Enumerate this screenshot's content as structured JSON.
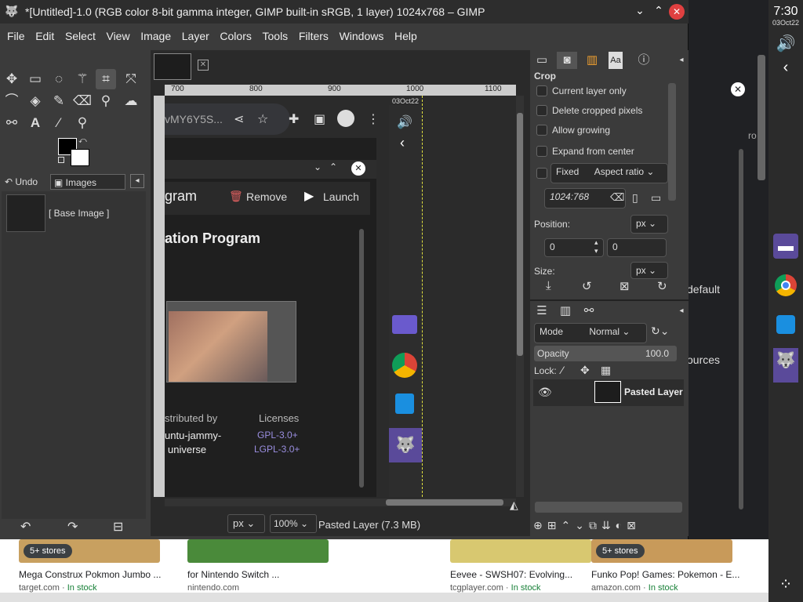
{
  "window": {
    "title": "*[Untitled]-1.0 (RGB color 8-bit gamma integer, GIMP built-in sRGB, 1 layer) 1024x768 – GIMP"
  },
  "system": {
    "time": "7:30",
    "date": "03Oct22"
  },
  "menubar": [
    "File",
    "Edit",
    "Select",
    "View",
    "Image",
    "Layer",
    "Colors",
    "Tools",
    "Filters",
    "Windows",
    "Help"
  ],
  "toolbox_tabs": {
    "undo": "Undo",
    "images": "Images"
  },
  "undo_history": {
    "base_image": "[ Base Image ]"
  },
  "crop": {
    "title": "Crop",
    "current_layer_only": "Current layer only",
    "delete_cropped_pixels": "Delete cropped pixels",
    "allow_growing": "Allow growing",
    "expand_from_center": "Expand from center",
    "fixed": "Fixed",
    "aspect_ratio": "Aspect ratio",
    "ratio_value": "1024:768",
    "position_label": "Position:",
    "unit_px": "px",
    "pos_x": "0",
    "pos_y": "0",
    "size_label": "Size:"
  },
  "layers": {
    "mode_label": "Mode",
    "mode_value": "Normal",
    "opacity_label": "Opacity",
    "opacity_value": "100.0",
    "lock_label": "Lock:",
    "layer_name": "Pasted Layer"
  },
  "statusbar": {
    "unit": "px",
    "zoom": "100%",
    "status_text": "Pasted Layer (7.3 MB)"
  },
  "ruler": {
    "ticks": [
      "700",
      "800",
      "900",
      "1000",
      "1100"
    ]
  },
  "canvas_content": {
    "url_fragment": "vMY6Y5S...",
    "date_overlay": "03Oct22",
    "app_title": "gram",
    "remove": "Remove",
    "launch": "Launch",
    "section_title": "ation Program",
    "distributed_by": "stributed by",
    "licenses": "Licenses",
    "distro_line1": "untu-jammy-",
    "distro_line2": "universe",
    "license1": "GPL-3.0+",
    "license2": "LGPL-3.0+"
  },
  "background_page": {
    "default_text": "default",
    "sources_text": "ources",
    "ro_text": "ro"
  },
  "shopping": [
    {
      "badge": "5+ stores",
      "title": "Mega Construx Pokmon Jumbo ...",
      "source": "target.com",
      "stock": "In stock",
      "color": "#c8a060"
    },
    {
      "badge": "",
      "title": "for Nintendo Switch ...",
      "source": "nintendo.com",
      "stock": "",
      "color": "#4a8a3a"
    },
    {
      "badge": "",
      "title": "Eevee - SWSH07: Evolving...",
      "source": "tcgplayer.com",
      "stock": "In stock",
      "color": "#d8c870"
    },
    {
      "badge": "5+ stores",
      "title": "Funko Pop! Games: Pokemon - E...",
      "source": "amazon.com",
      "stock": "In stock",
      "color": "#c89a5a"
    }
  ],
  "colors": {
    "accent": "#e04040",
    "license_link": "#9a8ee0"
  }
}
